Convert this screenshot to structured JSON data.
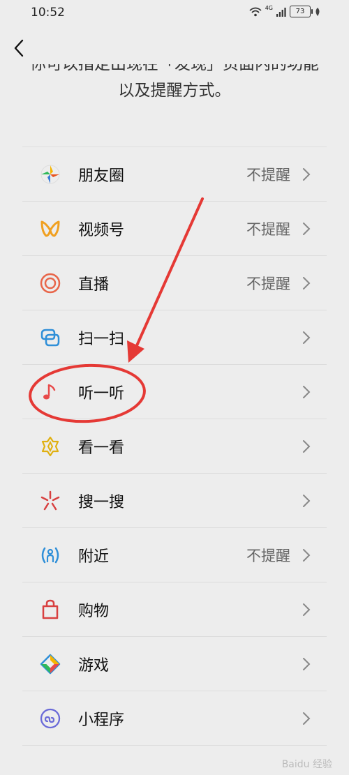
{
  "status_bar": {
    "time": "10:52",
    "network": "4G",
    "battery": "73"
  },
  "nav": {
    "back_icon": "chevron-left-icon"
  },
  "description": {
    "line1": "你可以指定出现在「发现」页面内的功能",
    "line2": "以及提醒方式。"
  },
  "items": [
    {
      "label": "朋友圈",
      "status": "不提醒",
      "icon": "moments-aperture-icon"
    },
    {
      "label": "视频号",
      "status": "不提醒",
      "icon": "channels-butterfly-icon"
    },
    {
      "label": "直播",
      "status": "不提醒",
      "icon": "live-concentric-circle-icon"
    },
    {
      "label": "扫一扫",
      "status": "",
      "icon": "scan-icon"
    },
    {
      "label": "听一听",
      "status": "",
      "icon": "music-note-icon"
    },
    {
      "label": "看一看",
      "status": "",
      "icon": "top-stories-star-icon"
    },
    {
      "label": "搜一搜",
      "status": "",
      "icon": "search-sparkle-icon"
    },
    {
      "label": "附近",
      "status": "不提醒",
      "icon": "nearby-person-icon"
    },
    {
      "label": "购物",
      "status": "",
      "icon": "shopping-bag-icon"
    },
    {
      "label": "游戏",
      "status": "",
      "icon": "game-diamond-icon"
    },
    {
      "label": "小程序",
      "status": "",
      "icon": "mini-program-icon"
    }
  ],
  "colors": {
    "background": "#ededed",
    "annotation": "#e53935"
  },
  "watermark": "Baidu 经验"
}
